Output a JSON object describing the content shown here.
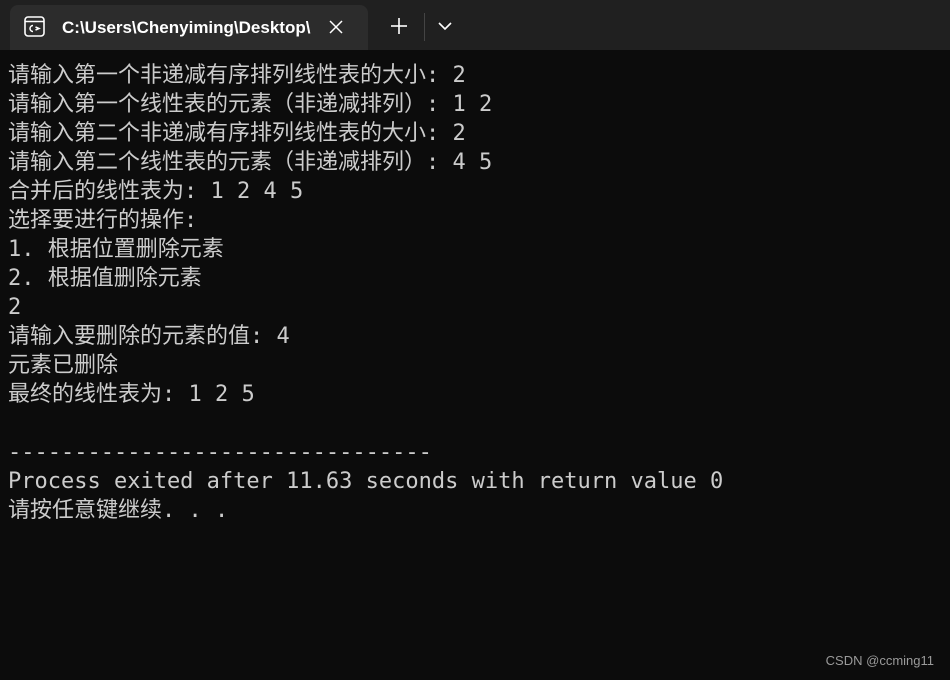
{
  "window": {
    "tab_title": "C:\\Users\\Chenyiming\\Desktop\\",
    "icons": {
      "tab": "console-icon",
      "close": "close-icon",
      "new_tab": "plus-icon",
      "dropdown": "chevron-down-icon"
    },
    "colors": {
      "background": "#0c0c0c",
      "tabstrip": "#202020",
      "tab_active": "#2c2c2c",
      "text": "#cccccc"
    }
  },
  "terminal": {
    "lines": [
      "请输入第一个非递减有序排列线性表的大小: 2",
      "请输入第一个线性表的元素（非递减排列）: 1 2",
      "请输入第二个非递减有序排列线性表的大小: 2",
      "请输入第二个线性表的元素（非递减排列）: 4 5",
      "合并后的线性表为: 1 2 4 5",
      "选择要进行的操作:",
      "1. 根据位置删除元素",
      "2. 根据值删除元素",
      "2",
      "请输入要删除的元素的值: 4",
      "元素已删除",
      "最终的线性表为: 1 2 5",
      "",
      "--------------------------------",
      "Process exited after 11.63 seconds with return value 0",
      "请按任意键继续. . ."
    ]
  },
  "watermark": "CSDN @ccming11"
}
